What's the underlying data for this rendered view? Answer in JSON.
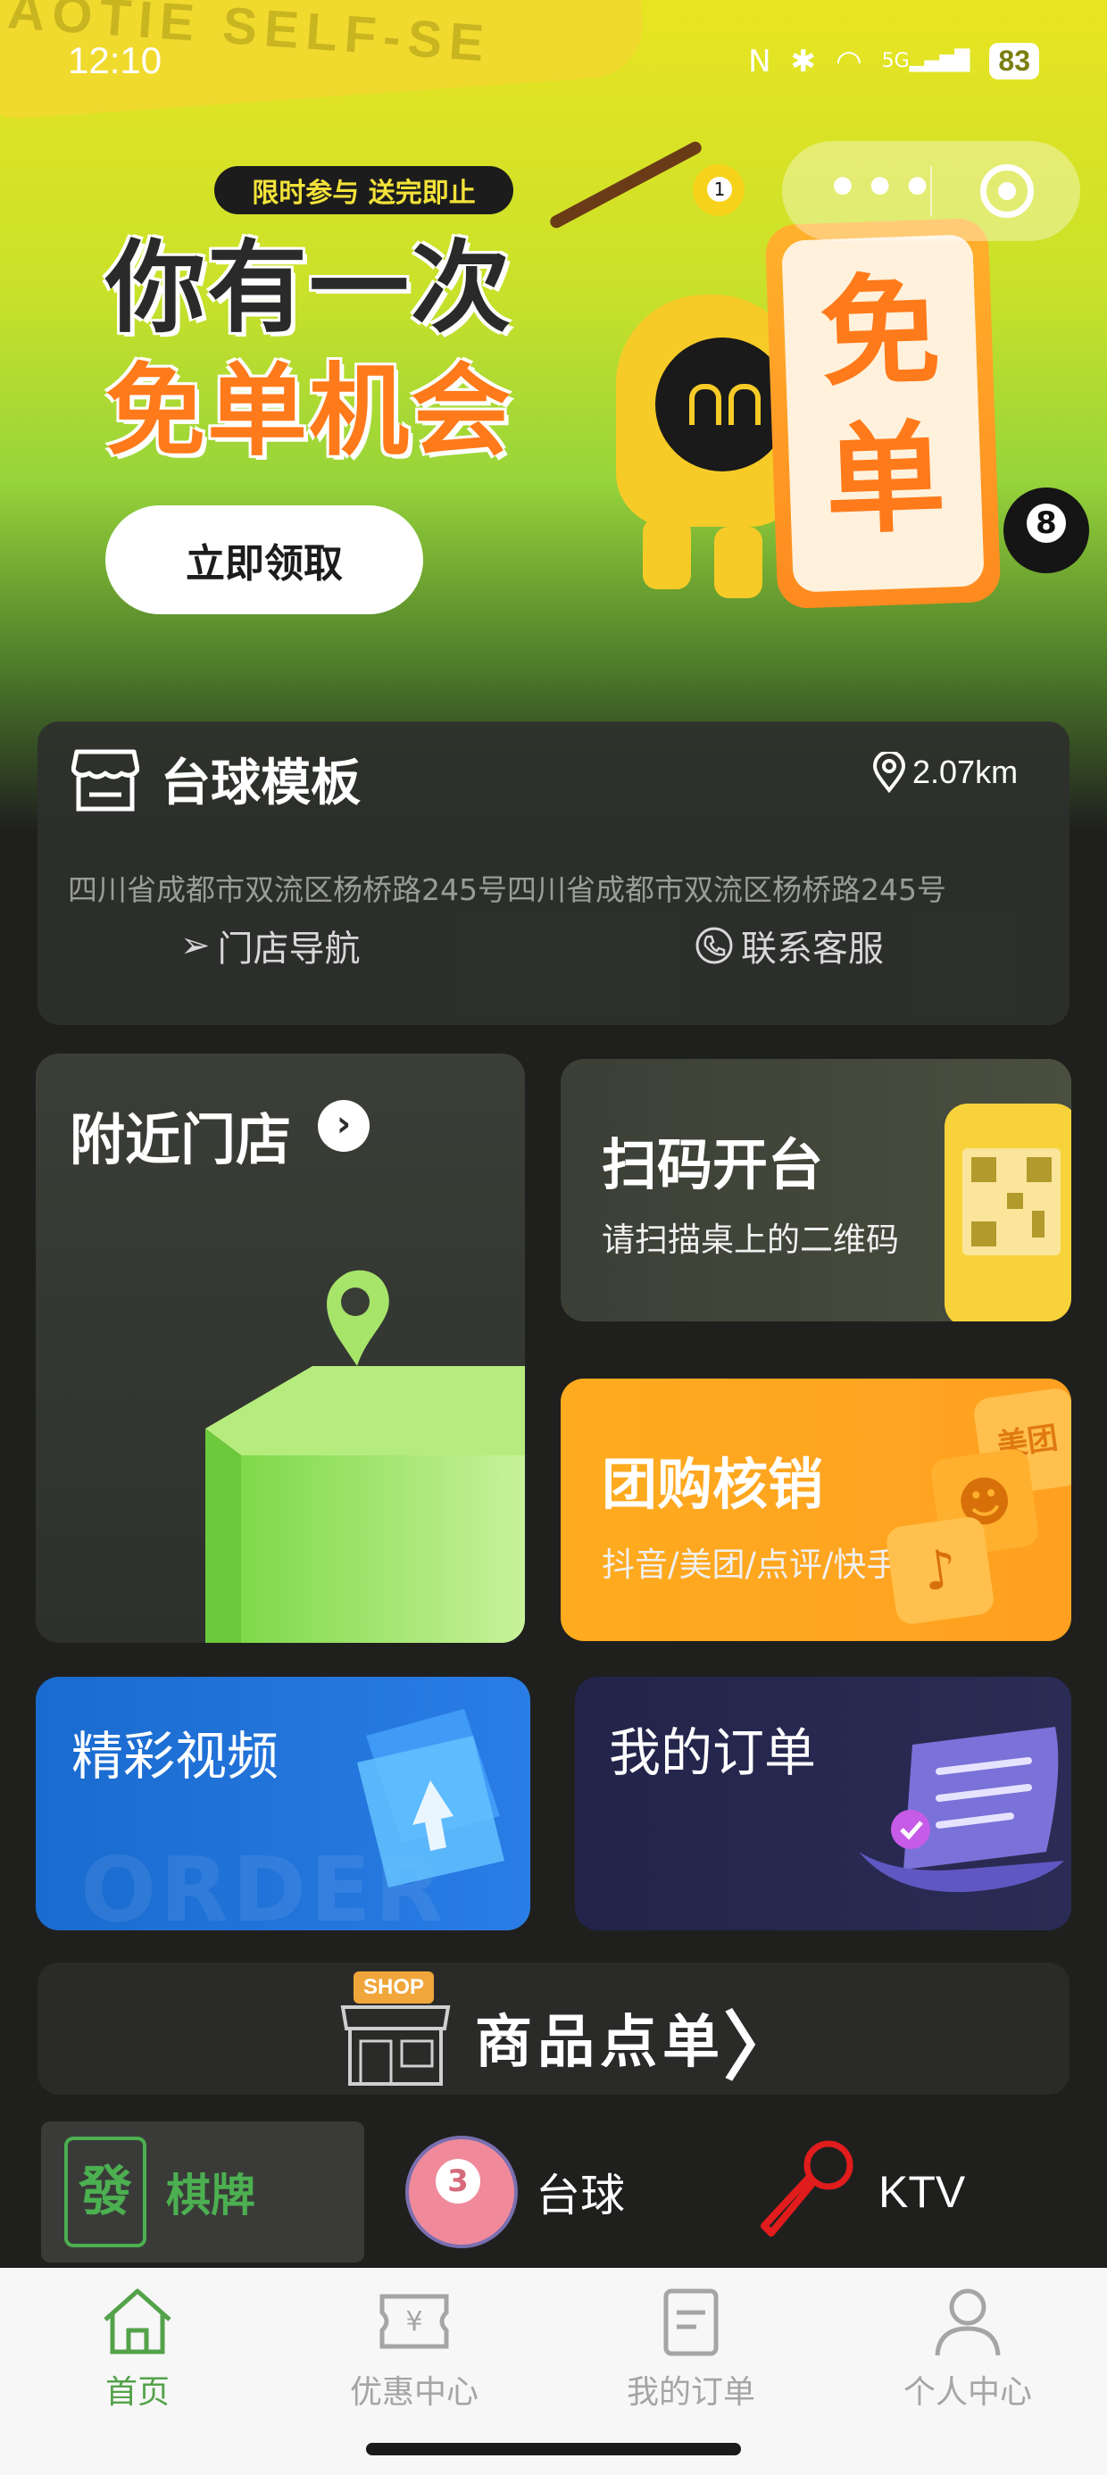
{
  "status_bar": {
    "time": "12:10",
    "battery": "83",
    "network": "5G"
  },
  "banner": {
    "ribbon_text": "TAOTIE   SELF-SE",
    "tag": "限时参与 送完即止",
    "headline_line1": "你有一次",
    "headline_line2": "免单机会",
    "claim_button": "立即领取",
    "free_card_text": "免单"
  },
  "store": {
    "name": "台球模板",
    "distance": "2.07km",
    "address": "四川省成都市双流区杨桥路245号四川省成都市双流区杨桥路245号",
    "navigate_label": "门店导航",
    "contact_label": "联系客服"
  },
  "tiles": {
    "nearby": {
      "title": "附近门店"
    },
    "scan": {
      "title": "扫码开台",
      "subtitle": "请扫描桌上的二维码"
    },
    "group": {
      "title": "团购核销",
      "subtitle": "抖音/美团/点评/快手",
      "deco_text": "美团"
    },
    "video": {
      "title": "精彩视频",
      "watermark": "ORDER"
    },
    "order": {
      "title": "我的订单"
    }
  },
  "shop": {
    "badge": "SHOP",
    "label": "商品点单"
  },
  "categories": [
    {
      "label": "棋牌",
      "icon_text": "發",
      "active": true
    },
    {
      "label": "台球",
      "icon_text": "3",
      "active": false
    },
    {
      "label": "KTV",
      "active": false
    }
  ],
  "tabbar": [
    {
      "label": "首页",
      "icon": "home-icon",
      "active": true
    },
    {
      "label": "优惠中心",
      "icon": "coupon-icon",
      "active": false
    },
    {
      "label": "我的订单",
      "icon": "order-icon",
      "active": false
    },
    {
      "label": "个人中心",
      "icon": "user-icon",
      "active": false
    }
  ],
  "colors": {
    "accent_green": "#53a24a",
    "orange": "#ffa020",
    "blue": "#1a6bcf",
    "navy": "#23244a"
  }
}
